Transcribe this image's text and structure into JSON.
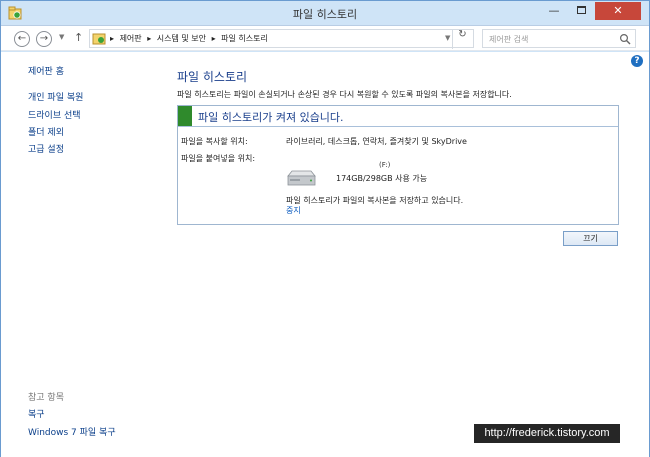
{
  "window": {
    "title": "파일 히스토리",
    "min_glyph": "—",
    "close_glyph": "✕"
  },
  "address": {
    "crumbs": [
      "제어판",
      "시스템 및 보안",
      "파일 히스토리"
    ],
    "search_placeholder": "제어판 검색"
  },
  "sidebar": {
    "home": "제어판 홈",
    "links": [
      "개인 파일 복원",
      "드라이브 선택",
      "폴더 제외",
      "고급 설정"
    ],
    "see_also_title": "참고 항목",
    "see_also": [
      "복구",
      "Windows 7 파일 복구"
    ]
  },
  "main": {
    "title": "파일 히스토리",
    "description": "파일 히스토리는 파일이 손실되거나 손상된 경우 다시 복원할 수 있도록 파일의 복사본을 저장합니다.",
    "status": "파일 히스토리가 켜져 있습니다.",
    "status_color": "#2f8a2c",
    "copy_from_label": "파일을 복사할 위치:",
    "copy_from_value": "라이브러리, 데스크톱, 연락처, 즐겨찾기 및 SkyDrive",
    "copy_to_label": "파일을 붙여넣을 위치:",
    "drive_name": "(F:)",
    "drive_space": "174GB/298GB 사용 가능",
    "saving_text": "파일 히스토리가 파일의 복사본을 저장하고 있습니다.",
    "stop_link": "중지",
    "off_button": "끄기"
  },
  "watermark": "http://frederick.tistory.com",
  "icons": {
    "app": "file-history-icon",
    "help": "help-icon",
    "drive": "hard-drive-icon"
  }
}
